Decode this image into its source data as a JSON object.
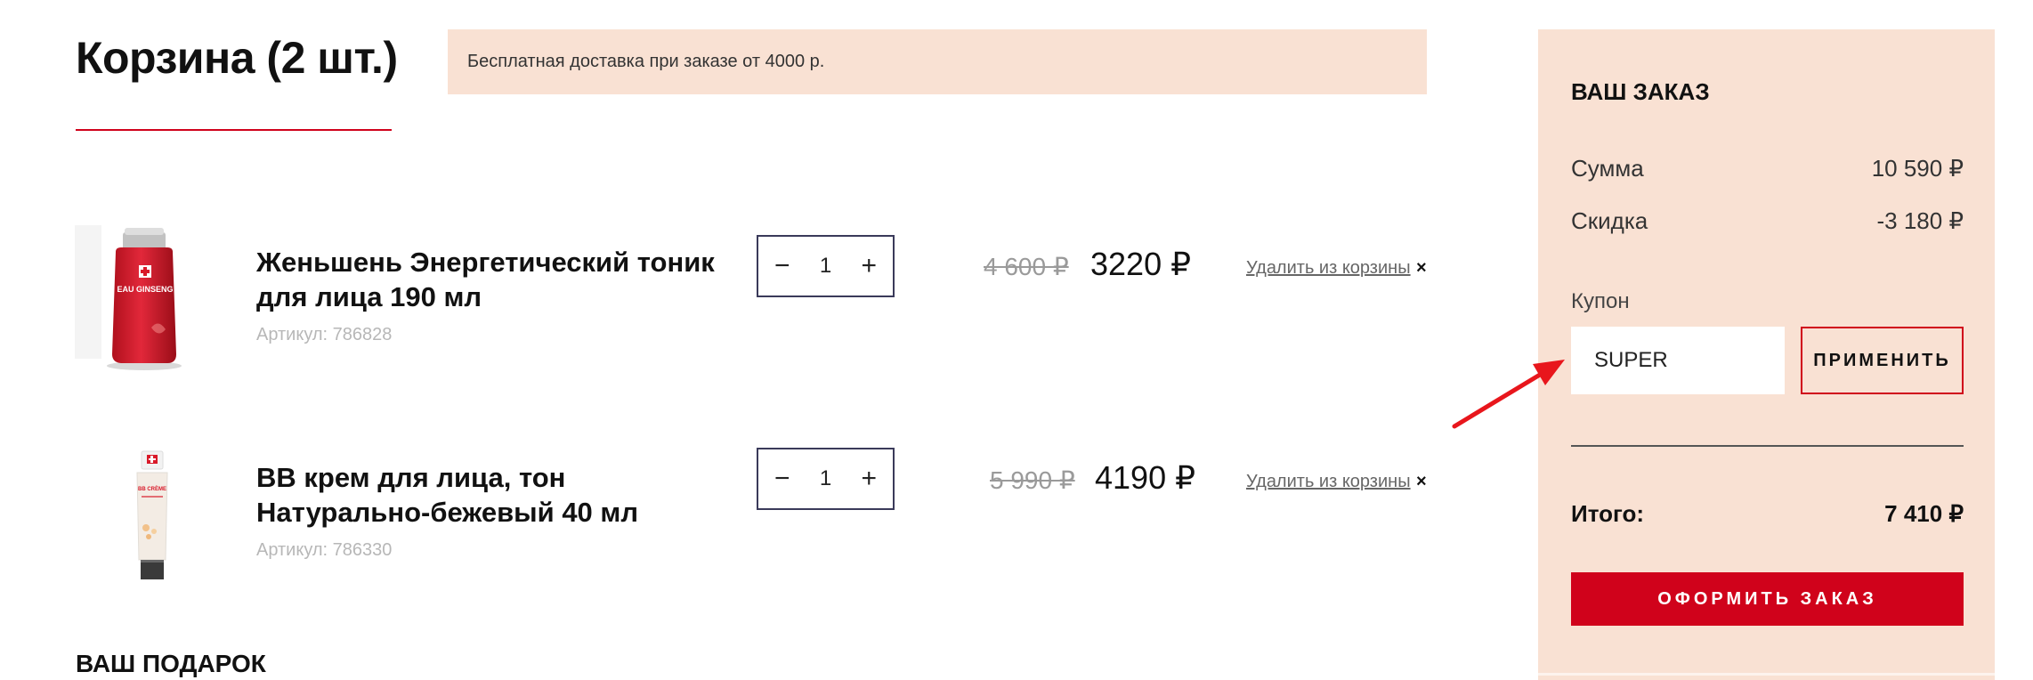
{
  "header": {
    "title": "Корзина (2 шт.)",
    "notice": "Бесплатная доставка при заказе от 4000 р."
  },
  "cart": {
    "items": [
      {
        "name": "Женьшень Энергетический тоник для лица 190 мл",
        "sku": "Артикул: 786828",
        "quantity": "1",
        "old_price": "4 600 ₽",
        "price": "3220 ₽",
        "remove_label": "Удалить из корзины",
        "remove_icon": "×",
        "image_label": "EAU GINSENG",
        "image_color": "#d91a2a"
      },
      {
        "name": "BB крем для лица, тон Натурально-бежевый 40 мл",
        "sku": "Артикул: 786330",
        "quantity": "1",
        "old_price": "5 990 ₽",
        "price": "4190 ₽",
        "remove_label": "Удалить из корзины",
        "remove_icon": "×",
        "image_label": "BB CRÈME",
        "image_color": "#f3ece4"
      }
    ],
    "qty_minus": "−",
    "qty_plus": "+"
  },
  "gift": {
    "heading": "ВАШ ПОДАРОК"
  },
  "summary": {
    "title": "ВАШ ЗАКАЗ",
    "sum_label": "Сумма",
    "sum_value": "10 590 ₽",
    "discount_label": "Скидка",
    "discount_value": "-3 180 ₽",
    "coupon_label": "Купон",
    "coupon_value": "SUPER",
    "apply_label": "ПРИМЕНИТЬ",
    "total_label": "Итого:",
    "total_value": "7 410 ₽",
    "checkout_label": "ОФОРМИТЬ ЗАКАЗ"
  },
  "colors": {
    "accent": "#d0021b",
    "panel": "#f9e1d3",
    "annotation_arrow": "#e8161c"
  }
}
